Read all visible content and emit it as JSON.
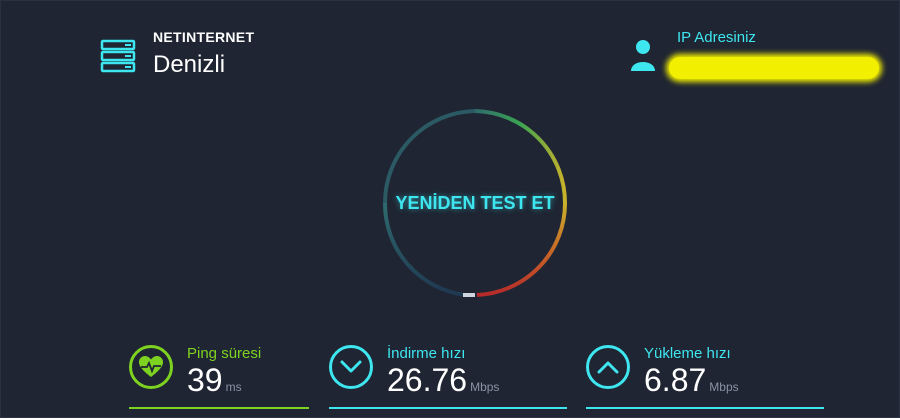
{
  "server": {
    "provider": "NETINTERNET",
    "city": "Denizli",
    "icon": "server-icon"
  },
  "ip": {
    "label": "IP Adresiniz",
    "icon": "user-icon",
    "value_redacted": true
  },
  "gauge": {
    "button_label": "YENİDEN TEST ET"
  },
  "stats": {
    "ping": {
      "label": "Ping süresi",
      "value": "39",
      "unit": "ms",
      "icon": "heartbeat-icon"
    },
    "download": {
      "label": "İndirme hızı",
      "value": "26.76",
      "unit": "Mbps",
      "icon": "chevron-down-icon"
    },
    "upload": {
      "label": "Yükleme hızı",
      "value": "6.87",
      "unit": "Mbps",
      "icon": "chevron-up-icon"
    }
  },
  "colors": {
    "background": "#1f2532",
    "accent_cyan": "#3ee6f0",
    "ping_green": "#7ed321",
    "redaction_yellow": "#f2ef00"
  }
}
